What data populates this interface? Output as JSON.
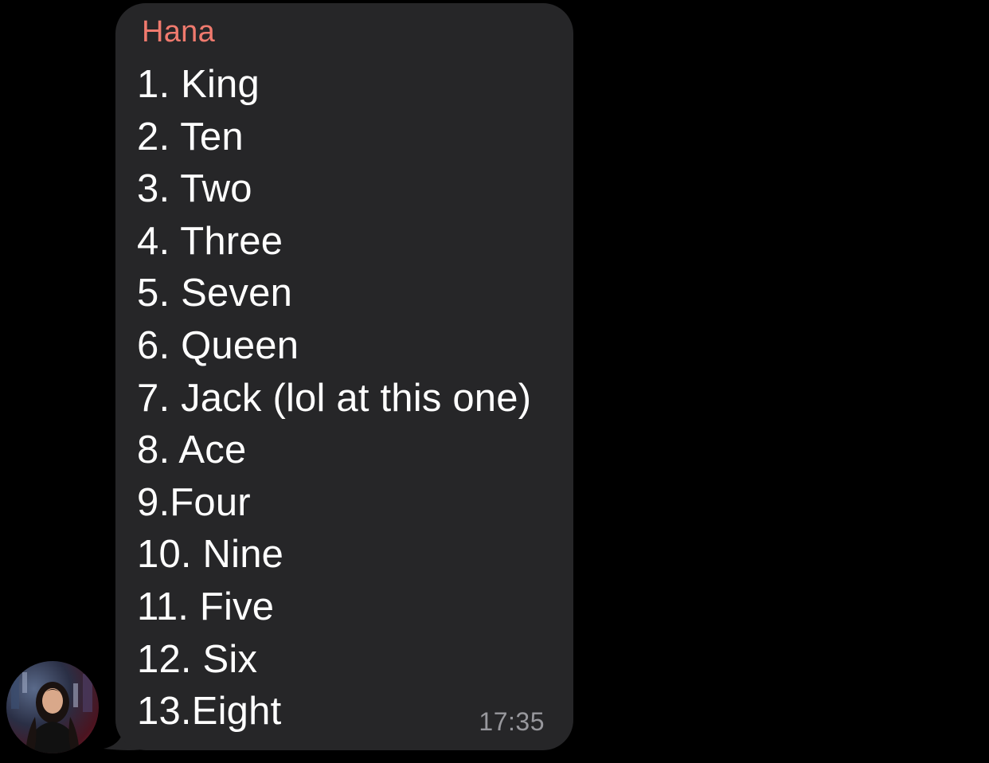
{
  "message": {
    "sender": "Hana",
    "lines": [
      "1. King",
      "2. Ten",
      "3. Two",
      "4. Three",
      "5. Seven",
      "6. Queen",
      "7. Jack (lol at this one)",
      "8. Ace",
      "9.Four",
      "10. Nine",
      "11. Five",
      "12. Six",
      "13.Eight"
    ],
    "timestamp": "17:35"
  },
  "colors": {
    "background": "#000000",
    "bubble": "#262628",
    "sender_name": "#f07a6e",
    "text": "#ffffff",
    "timestamp": "#98989d"
  },
  "icons": {
    "avatar": "user-avatar-photo"
  }
}
